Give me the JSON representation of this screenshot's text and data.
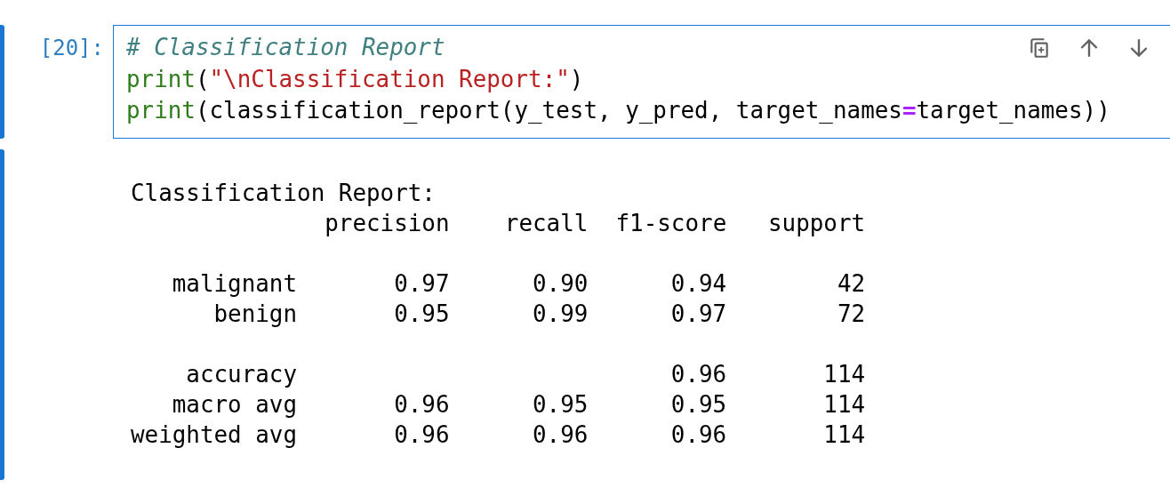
{
  "code_cell": {
    "prompt": "[20]:",
    "lines": [
      [
        {
          "kind": "comment",
          "text": "# Classification Report"
        }
      ],
      [
        {
          "kind": "builtin",
          "text": "print"
        },
        {
          "kind": "plain",
          "text": "("
        },
        {
          "kind": "string",
          "text": "\"\\nClassification Report:\""
        },
        {
          "kind": "plain",
          "text": ")"
        }
      ],
      [
        {
          "kind": "builtin",
          "text": "print"
        },
        {
          "kind": "plain",
          "text": "(classification_report(y_test, y_pred, target_names"
        },
        {
          "kind": "operator",
          "text": "="
        },
        {
          "kind": "plain",
          "text": "target_names))"
        }
      ]
    ],
    "toolbar": [
      {
        "kind": "duplicate"
      },
      {
        "kind": "move-up"
      },
      {
        "kind": "move-down"
      }
    ]
  },
  "output_cell": {
    "title": "Classification Report:",
    "columns": [
      "precision",
      "recall",
      "f1-score",
      "support"
    ],
    "groups": [
      [
        {
          "label": "malignant",
          "precision": "0.97",
          "recall": "0.90",
          "f1_score": "0.94",
          "support": "42"
        },
        {
          "label": "benign",
          "precision": "0.95",
          "recall": "0.99",
          "f1_score": "0.97",
          "support": "72"
        }
      ],
      [
        {
          "label": "accuracy",
          "f1_score": "0.96",
          "support": "114"
        },
        {
          "label": "macro avg",
          "precision": "0.96",
          "recall": "0.95",
          "f1_score": "0.95",
          "support": "114"
        },
        {
          "label": "weighted avg",
          "precision": "0.96",
          "recall": "0.96",
          "f1_score": "0.96",
          "support": "114"
        }
      ]
    ]
  }
}
